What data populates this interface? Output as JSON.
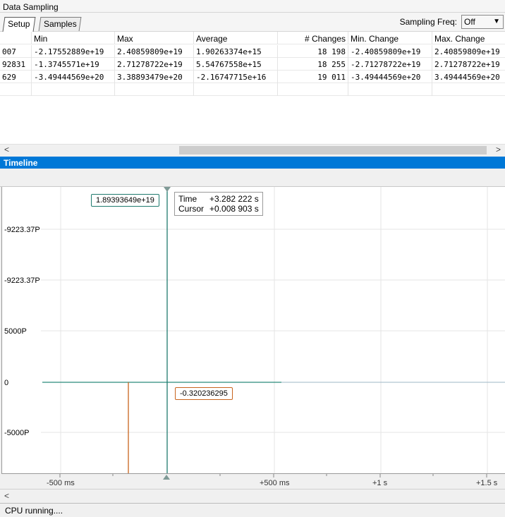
{
  "panel": {
    "title": "Data Sampling"
  },
  "tabs": [
    {
      "label": "Setup"
    },
    {
      "label": "Samples"
    }
  ],
  "sampling": {
    "label": "Sampling Freq:",
    "value": "Off"
  },
  "table": {
    "headers": [
      "",
      "Min",
      "Max",
      "Average",
      "# Changes",
      "Min. Change",
      "Max. Change"
    ],
    "rows": [
      [
        "007",
        "-2.17552889e+19",
        "2.40859809e+19",
        "1.90263374e+15",
        "18 198",
        "-2.40859809e+19",
        "2.40859809e+19"
      ],
      [
        "92831",
        "-1.3745571e+19",
        "2.71278722e+19",
        "5.54767558e+15",
        "18 255",
        "-2.71278722e+19",
        "2.71278722e+19"
      ],
      [
        "629",
        "-3.49444569e+20",
        "3.38893479e+20",
        "-2.16747715e+16",
        "19 011",
        "-3.49444569e+20",
        "3.49444569e+20"
      ]
    ]
  },
  "timeline": {
    "title": "Timeline",
    "y_labels": [
      "-9223.37P",
      "-9223.37P",
      "5000P",
      "0",
      "-5000P"
    ],
    "x_labels": [
      "-500 ms",
      "+500 ms",
      "+1 s",
      "+1.5 s"
    ],
    "cursor_value": "1.89393649e+19",
    "signal_value": "-0.320236295",
    "tooltip": {
      "time_label": "Time",
      "time_value": "+3.282 222 s",
      "cursor_label": "Cursor",
      "cursor_value": "+0.008 903 s"
    },
    "colors": {
      "cursor": "#1f7a6e",
      "signal": "#c8641e",
      "trace": "#2a8a7a"
    }
  },
  "status": {
    "text": "CPU running...."
  }
}
